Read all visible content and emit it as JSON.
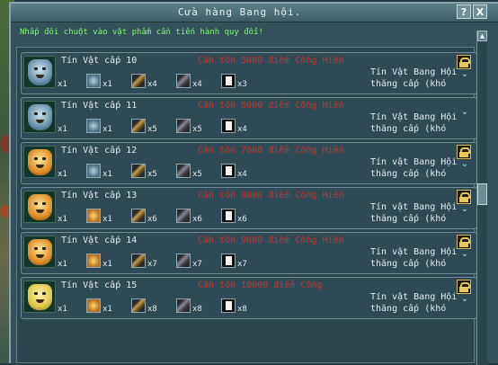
{
  "window": {
    "title": "Cửa hàng Bang hội.",
    "help_label": "?",
    "close_label": "X",
    "instruction": "Nhấp đôi chuột vào vật phẩm cần tiến hành quy đổi!"
  },
  "rows": [
    {
      "name": "Tín Vật cấp 10",
      "cost": "Cần tốn 5000 điểm Cống Hiến",
      "qty_main": "x1",
      "qty_mask": "x1",
      "qty_stick": "x4",
      "qty_ore": "x4",
      "qty_paper": "x3",
      "desc1": "Tín Vật Bang Hội",
      "desc2": "thăng cấp (khó",
      "icon": "mask-blue-icon"
    },
    {
      "name": "Tín Vật cấp 11",
      "cost": "Cần tốn 6000 điểm Cống Hiến",
      "qty_main": "x1",
      "qty_mask": "x1",
      "qty_stick": "x5",
      "qty_ore": "x5",
      "qty_paper": "x4",
      "desc1": "Tín Vật Bang Hội",
      "desc2": "thăng cấp (khó",
      "icon": "mask-blue-icon"
    },
    {
      "name": "Tín Vật cấp 12",
      "cost": "Cần tốn 7000 điểm Cống Hiến",
      "qty_main": "x1",
      "qty_mask": "x1",
      "qty_stick": "x5",
      "qty_ore": "x5",
      "qty_paper": "x4",
      "desc1": "Tín vật Bang Hội",
      "desc2": "thăng cấp (khó",
      "icon": "mask-gold-icon"
    },
    {
      "name": "Tín Vật cấp 13",
      "cost": "Cần tốn 8000 điểm Cống Hiến",
      "qty_main": "x1",
      "qty_mask": "x1",
      "qty_stick": "x6",
      "qty_ore": "x6",
      "qty_paper": "x6",
      "desc1": "Tín vật Bang Hội",
      "desc2": "thăng cấp (khó",
      "icon": "mask-gold-icon"
    },
    {
      "name": "Tín Vật cấp 14",
      "cost": "Cần tốn 9000 điểm Cống Hiến",
      "qty_main": "x1",
      "qty_mask": "x1",
      "qty_stick": "x7",
      "qty_ore": "x7",
      "qty_paper": "x7",
      "desc1": "Tín vật Bang Hội",
      "desc2": "thăng cấp (khó",
      "icon": "mask-gold-icon"
    },
    {
      "name": "Tín Vật cấp 15",
      "cost": "Cần tốn 10000 điểm Cống",
      "qty_main": "x1",
      "qty_mask": "x1",
      "qty_stick": "x8",
      "qty_ore": "x8",
      "qty_paper": "x8",
      "desc1": "Tín vật Bang Hội",
      "desc2": "thăng cấp (khó",
      "icon": "mask-lightgold-icon"
    }
  ],
  "scrollbar": {
    "up": "▲",
    "down": "▼"
  },
  "colors": {
    "cost": "#d63020",
    "instruction": "#7dff6a",
    "window": "#34505c"
  }
}
